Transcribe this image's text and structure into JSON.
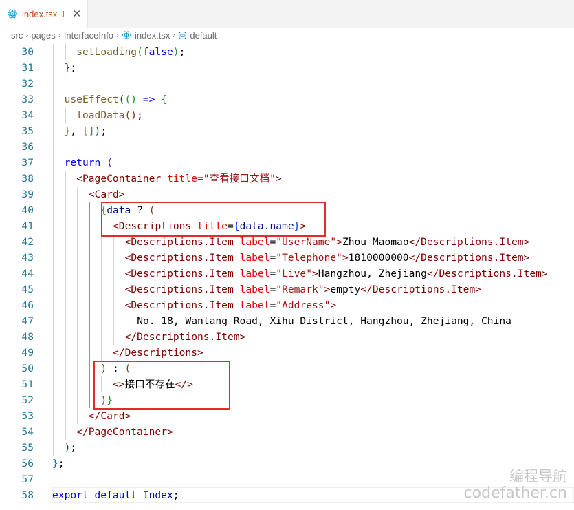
{
  "tab": {
    "filename": "index.tsx",
    "problems": "1",
    "close": "✕"
  },
  "breadcrumb": {
    "items": [
      "src",
      "pages",
      "InterfaceInfo",
      "index.tsx",
      "default"
    ],
    "separator": "›"
  },
  "code_lines": [
    {
      "n": "30",
      "ind": 2,
      "t": [
        [
          "fn",
          "setLoading"
        ],
        [
          "br2",
          "("
        ],
        [
          "kw",
          "false"
        ],
        [
          "br2",
          ")"
        ],
        [
          "pun",
          ";"
        ]
      ]
    },
    {
      "n": "31",
      "ind": 1,
      "t": [
        [
          "br1",
          "}"
        ],
        [
          "pun",
          ";"
        ]
      ]
    },
    {
      "n": "32",
      "ind": 0,
      "t": []
    },
    {
      "n": "33",
      "ind": 1,
      "t": [
        [
          "fn",
          "useEffect"
        ],
        [
          "br1",
          "("
        ],
        [
          "br2",
          "()"
        ],
        [
          "pun",
          " "
        ],
        [
          "kw",
          "=>"
        ],
        [
          "pun",
          " "
        ],
        [
          "br2",
          "{"
        ]
      ]
    },
    {
      "n": "34",
      "ind": 2,
      "t": [
        [
          "fn",
          "loadData"
        ],
        [
          "br3",
          "()"
        ],
        [
          "pun",
          ";"
        ]
      ]
    },
    {
      "n": "35",
      "ind": 1,
      "t": [
        [
          "br2",
          "}"
        ],
        [
          "pun",
          ", "
        ],
        [
          "br2",
          "[]"
        ],
        [
          "br1",
          ")"
        ],
        [
          "pun",
          ";"
        ]
      ]
    },
    {
      "n": "36",
      "ind": 0,
      "t": []
    },
    {
      "n": "37",
      "ind": 1,
      "t": [
        [
          "kw",
          "return"
        ],
        [
          "pun",
          " "
        ],
        [
          "br1",
          "("
        ]
      ]
    },
    {
      "n": "38",
      "ind": 2,
      "t": [
        [
          "tag",
          "<PageContainer"
        ],
        [
          "pun",
          " "
        ],
        [
          "attr",
          "title"
        ],
        [
          "pun",
          "="
        ],
        [
          "str",
          "\"查看接口文档\""
        ],
        [
          "tag",
          ">"
        ]
      ]
    },
    {
      "n": "39",
      "ind": 3,
      "t": [
        [
          "tag",
          "<Card>"
        ]
      ]
    },
    {
      "n": "40",
      "ind": 4,
      "t": [
        [
          "br2",
          "{"
        ],
        [
          "var",
          "data"
        ],
        [
          "pun",
          " ? "
        ],
        [
          "br3",
          "("
        ]
      ]
    },
    {
      "n": "41",
      "ind": 5,
      "t": [
        [
          "tag",
          "<Descriptions"
        ],
        [
          "pun",
          " "
        ],
        [
          "attr",
          "title"
        ],
        [
          "pun",
          "="
        ],
        [
          "br1",
          "{"
        ],
        [
          "var",
          "data"
        ],
        [
          "pun",
          "."
        ],
        [
          "var",
          "name"
        ],
        [
          "br1",
          "}"
        ],
        [
          "tag",
          ">"
        ]
      ]
    },
    {
      "n": "42",
      "ind": 6,
      "t": [
        [
          "tag",
          "<Descriptions.Item"
        ],
        [
          "pun",
          " "
        ],
        [
          "attr",
          "label"
        ],
        [
          "pun",
          "="
        ],
        [
          "str",
          "\"UserName\""
        ],
        [
          "tag",
          ">"
        ],
        [
          "txt",
          "Zhou Maomao"
        ],
        [
          "tag",
          "</Descriptions.Item>"
        ]
      ]
    },
    {
      "n": "43",
      "ind": 6,
      "t": [
        [
          "tag",
          "<Descriptions.Item"
        ],
        [
          "pun",
          " "
        ],
        [
          "attr",
          "label"
        ],
        [
          "pun",
          "="
        ],
        [
          "str",
          "\"Telephone\""
        ],
        [
          "tag",
          ">"
        ],
        [
          "txt",
          "1810000000"
        ],
        [
          "tag",
          "</Descriptions.Item>"
        ]
      ]
    },
    {
      "n": "44",
      "ind": 6,
      "t": [
        [
          "tag",
          "<Descriptions.Item"
        ],
        [
          "pun",
          " "
        ],
        [
          "attr",
          "label"
        ],
        [
          "pun",
          "="
        ],
        [
          "str",
          "\"Live\""
        ],
        [
          "tag",
          ">"
        ],
        [
          "txt",
          "Hangzhou, Zhejiang"
        ],
        [
          "tag",
          "</Descriptions.Item>"
        ]
      ]
    },
    {
      "n": "45",
      "ind": 6,
      "t": [
        [
          "tag",
          "<Descriptions.Item"
        ],
        [
          "pun",
          " "
        ],
        [
          "attr",
          "label"
        ],
        [
          "pun",
          "="
        ],
        [
          "str",
          "\"Remark\""
        ],
        [
          "tag",
          ">"
        ],
        [
          "txt",
          "empty"
        ],
        [
          "tag",
          "</Descriptions.Item>"
        ]
      ]
    },
    {
      "n": "46",
      "ind": 6,
      "t": [
        [
          "tag",
          "<Descriptions.Item"
        ],
        [
          "pun",
          " "
        ],
        [
          "attr",
          "label"
        ],
        [
          "pun",
          "="
        ],
        [
          "str",
          "\"Address\""
        ],
        [
          "tag",
          ">"
        ]
      ]
    },
    {
      "n": "47",
      "ind": 7,
      "t": [
        [
          "txt",
          "No. 18, Wantang Road, Xihu District, Hangzhou, Zhejiang, China"
        ]
      ]
    },
    {
      "n": "48",
      "ind": 6,
      "t": [
        [
          "tag",
          "</Descriptions.Item>"
        ]
      ]
    },
    {
      "n": "49",
      "ind": 5,
      "t": [
        [
          "tag",
          "</Descriptions>"
        ]
      ]
    },
    {
      "n": "50",
      "ind": 4,
      "t": [
        [
          "br3",
          ")"
        ],
        [
          "pun",
          " : "
        ],
        [
          "br3",
          "("
        ]
      ]
    },
    {
      "n": "51",
      "ind": 5,
      "t": [
        [
          "tag",
          "<>"
        ],
        [
          "txt",
          "接口不存在"
        ],
        [
          "tag",
          "</>"
        ]
      ]
    },
    {
      "n": "52",
      "ind": 4,
      "t": [
        [
          "br3",
          ")"
        ],
        [
          "br2",
          "}"
        ]
      ]
    },
    {
      "n": "53",
      "ind": 3,
      "t": [
        [
          "tag",
          "</Card>"
        ]
      ]
    },
    {
      "n": "54",
      "ind": 2,
      "t": [
        [
          "tag",
          "</PageContainer>"
        ]
      ]
    },
    {
      "n": "55",
      "ind": 1,
      "t": [
        [
          "br1",
          ")"
        ],
        [
          "pun",
          ";"
        ]
      ]
    },
    {
      "n": "56",
      "ind": 0,
      "t": [
        [
          "lb",
          "}"
        ],
        [
          "pun",
          ";"
        ]
      ]
    },
    {
      "n": "57",
      "ind": 0,
      "t": []
    },
    {
      "n": "58",
      "ind": 0,
      "t": [
        [
          "kw",
          "export"
        ],
        [
          "pun",
          " "
        ],
        [
          "kw",
          "default"
        ],
        [
          "pun",
          " "
        ],
        [
          "var",
          "Index"
        ],
        [
          "pun",
          ";"
        ]
      ]
    }
  ],
  "watermark": {
    "line1": "编程导航",
    "line2": "codefather.cn"
  }
}
